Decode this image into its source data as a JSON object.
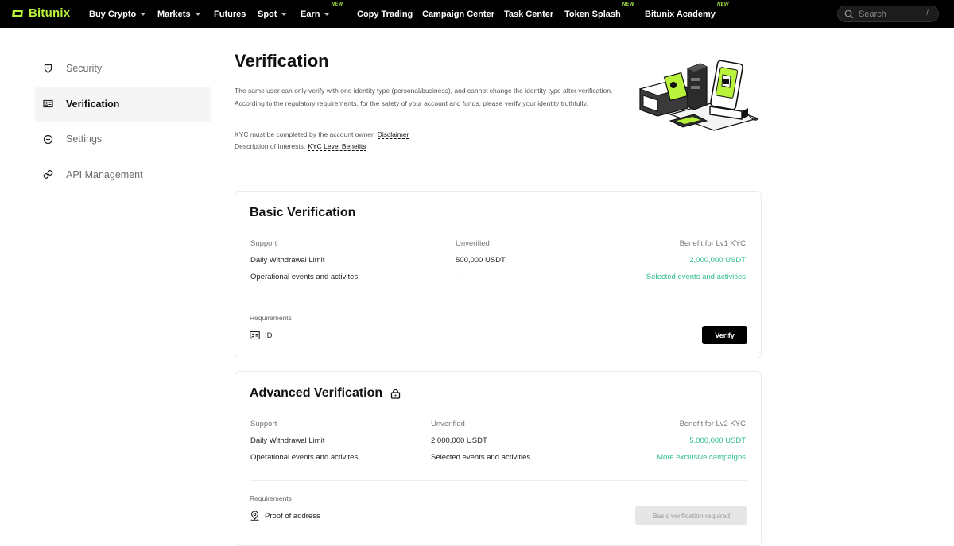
{
  "brand": {
    "name": "Bitunix",
    "color": "#b8f23b"
  },
  "nav": {
    "items": [
      {
        "label": "Buy Crypto",
        "caret": true,
        "new": false
      },
      {
        "label": "Markets",
        "caret": true,
        "new": false
      },
      {
        "label": "Futures",
        "caret": false,
        "new": false
      },
      {
        "label": "Spot",
        "caret": true,
        "new": false
      },
      {
        "label": "Earn",
        "caret": true,
        "new": true
      },
      {
        "label": "Copy Trading",
        "caret": false,
        "new": false
      },
      {
        "label": "Campaign Center",
        "caret": false,
        "new": false
      },
      {
        "label": "Task Center",
        "caret": false,
        "new": false
      },
      {
        "label": "Token Splash",
        "caret": false,
        "new": true
      },
      {
        "label": "Bitunix Academy",
        "caret": false,
        "new": true
      }
    ],
    "new_badge": "NEW",
    "search_placeholder": "Search",
    "search_shortcut": "/"
  },
  "sidebar": {
    "items": [
      {
        "label": "Security",
        "icon": "shield-icon",
        "active": false
      },
      {
        "label": "Verification",
        "icon": "id-card-icon",
        "active": true
      },
      {
        "label": "Settings",
        "icon": "settings-icon",
        "active": false
      },
      {
        "label": "API Management",
        "icon": "link-icon",
        "active": false
      }
    ]
  },
  "page": {
    "title": "Verification",
    "intro_1": "The same user can only verify with one identity type (personal/business), and cannot change the identity type after verification.",
    "intro_2": "According to the regulatory requirements, for the safety of your account and funds, please verify your identity truthfully.",
    "kyc_prefix": "KYC must be completed by the account owner,",
    "kyc_link": "Disclaimer",
    "interest_prefix": "Description of Interests,",
    "interest_link": "KYC Level Benefits"
  },
  "basic": {
    "title": "Basic Verification",
    "col1": "Support",
    "col2": "Unverified",
    "col3": "Benefit for Lv1 KYC",
    "row1": {
      "label": "Daily Withdrawal Limit",
      "unverified": "500,000  USDT",
      "benefit": "2,000,000  USDT"
    },
    "row2": {
      "label": "Operational events and activites",
      "unverified": "-",
      "benefit": "Selected events and activities"
    },
    "req_label": "Requirements",
    "req_item": "ID",
    "button": "Verify"
  },
  "advanced": {
    "title": "Advanced Verification",
    "col1": "Support",
    "col2": "Unverified",
    "col3": "Benefit for Lv2 KYC",
    "row1": {
      "label": "Daily Withdrawal Limit",
      "unverified": "2,000,000  USDT",
      "benefit": "5,000,000  USDT"
    },
    "row2": {
      "label": "Operational events and activites",
      "unverified": "Selected events and activities",
      "benefit": "More exclusive campaigns"
    },
    "req_label": "Requirements",
    "req_item": "Proof of address",
    "button": "Basic verification required"
  },
  "colors": {
    "accent_green": "#2ebd85",
    "nav_bg": "#000000"
  }
}
